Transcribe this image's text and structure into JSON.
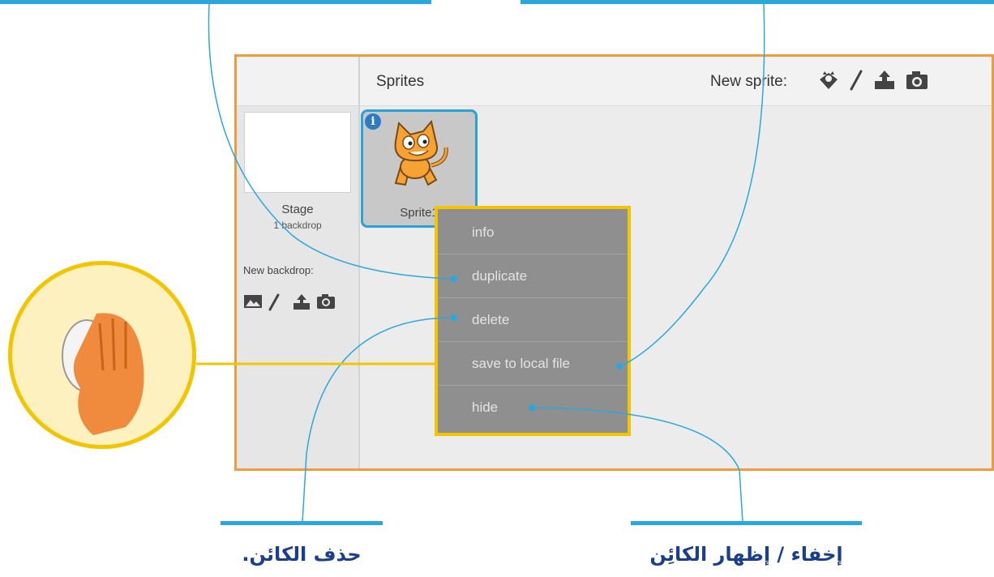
{
  "captions": {
    "delete_caption": "حذف الكائن.",
    "hide_caption": "إخفاء / إظهار الكائِن"
  },
  "stage": {
    "title": "Stage",
    "subtitle": "1 backdrop",
    "new_backdrop_label": "New backdrop:"
  },
  "sprites_panel": {
    "title": "Sprites",
    "new_sprite_label": "New sprite:",
    "sprite_name": "Sprite1",
    "info_badge": "i"
  },
  "context_menu": {
    "items": [
      "info",
      "duplicate",
      "delete",
      "save to local file",
      "hide"
    ]
  },
  "icons": {
    "new_sprite": [
      "sprite-library-icon",
      "paint-brush-icon",
      "upload-icon",
      "camera-icon"
    ],
    "new_backdrop": [
      "image-library-icon",
      "paint-brush-icon",
      "upload-icon",
      "camera-icon"
    ]
  },
  "colors": {
    "callout_blue": "#29a8e0",
    "pane_border": "#f39a3c",
    "menu_border": "#f2c500",
    "caption_text": "#1b3f8f"
  }
}
